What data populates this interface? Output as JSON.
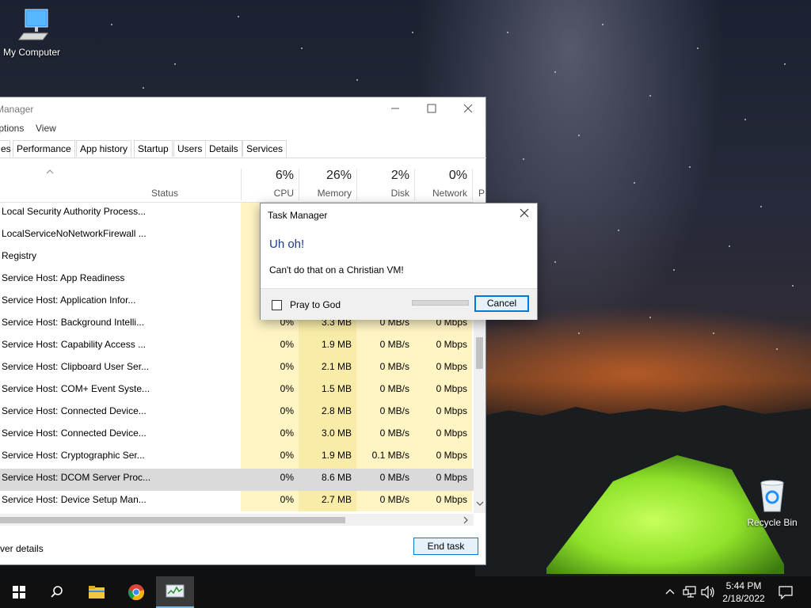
{
  "desktop": {
    "icons": [
      {
        "label": "My Computer"
      },
      {
        "label": "Recycle Bin"
      }
    ]
  },
  "task_manager": {
    "title": "Task Manager",
    "menu": [
      "Options",
      "View"
    ],
    "tabs": [
      "es",
      "Performance",
      "App history",
      "Startup",
      "Users",
      "Details",
      "Services"
    ],
    "columns": {
      "status": "Status",
      "cpu": {
        "pct": "6%",
        "label": "CPU"
      },
      "memory": {
        "pct": "26%",
        "label": "Memory"
      },
      "disk": {
        "pct": "2%",
        "label": "Disk"
      },
      "network": {
        "pct": "0%",
        "label": "Network"
      },
      "power": "P"
    },
    "rows": [
      {
        "name": "Local Security Authority Process...",
        "cpu": "",
        "mem": "",
        "disk": "",
        "net": ""
      },
      {
        "name": "LocalServiceNoNetworkFirewall ...",
        "cpu": "",
        "mem": "",
        "disk": "",
        "net": ""
      },
      {
        "name": "Registry",
        "cpu": "",
        "mem": "",
        "disk": "",
        "net": ""
      },
      {
        "name": "Service Host: App Readiness",
        "cpu": "",
        "mem": "",
        "disk": "",
        "net": ""
      },
      {
        "name": "Service Host: Application Infor...",
        "cpu": "",
        "mem": "",
        "disk": "",
        "net": ""
      },
      {
        "name": "Service Host: Background Intelli...",
        "cpu": "0%",
        "mem": "3.3 MB",
        "disk": "0 MB/s",
        "net": "0 Mbps"
      },
      {
        "name": "Service Host: Capability Access ...",
        "cpu": "0%",
        "mem": "1.9 MB",
        "disk": "0 MB/s",
        "net": "0 Mbps"
      },
      {
        "name": "Service Host: Clipboard User Ser...",
        "cpu": "0%",
        "mem": "2.1 MB",
        "disk": "0 MB/s",
        "net": "0 Mbps"
      },
      {
        "name": "Service Host: COM+ Event Syste...",
        "cpu": "0%",
        "mem": "1.5 MB",
        "disk": "0 MB/s",
        "net": "0 Mbps"
      },
      {
        "name": "Service Host: Connected Device...",
        "cpu": "0%",
        "mem": "2.8 MB",
        "disk": "0 MB/s",
        "net": "0 Mbps"
      },
      {
        "name": "Service Host: Connected Device...",
        "cpu": "0%",
        "mem": "3.0 MB",
        "disk": "0 MB/s",
        "net": "0 Mbps"
      },
      {
        "name": "Service Host: Cryptographic Ser...",
        "cpu": "0%",
        "mem": "1.9 MB",
        "disk": "0.1 MB/s",
        "net": "0 Mbps"
      },
      {
        "name": "Service Host: DCOM Server Proc...",
        "cpu": "0%",
        "mem": "8.6 MB",
        "disk": "0 MB/s",
        "net": "0 Mbps",
        "selected": true
      },
      {
        "name": "Service Host: Device Setup Man...",
        "cpu": "0%",
        "mem": "2.7 MB",
        "disk": "0 MB/s",
        "net": "0 Mbps"
      }
    ],
    "fewer_details": "ver details",
    "end_task": "End task"
  },
  "dialog": {
    "title": "Task Manager",
    "heading": "Uh oh!",
    "message": "Can't do that on a Christian VM!",
    "checkbox_label": "Pray to God",
    "checkbox_checked": false,
    "progress": 0,
    "cancel": "Cancel"
  },
  "taskbar": {
    "items": [
      "windows-start-icon",
      "search-icon",
      "file-explorer-icon",
      "chrome-icon",
      "task-manager-icon"
    ],
    "active": "task-manager-icon",
    "time": "5:44 PM",
    "date": "2/18/2022"
  },
  "colors": {
    "accent": "#0078d7",
    "heat_light": "#fff4c4",
    "heat_medium": "#f9eca8",
    "dialog_heading": "#1e3a8a"
  }
}
